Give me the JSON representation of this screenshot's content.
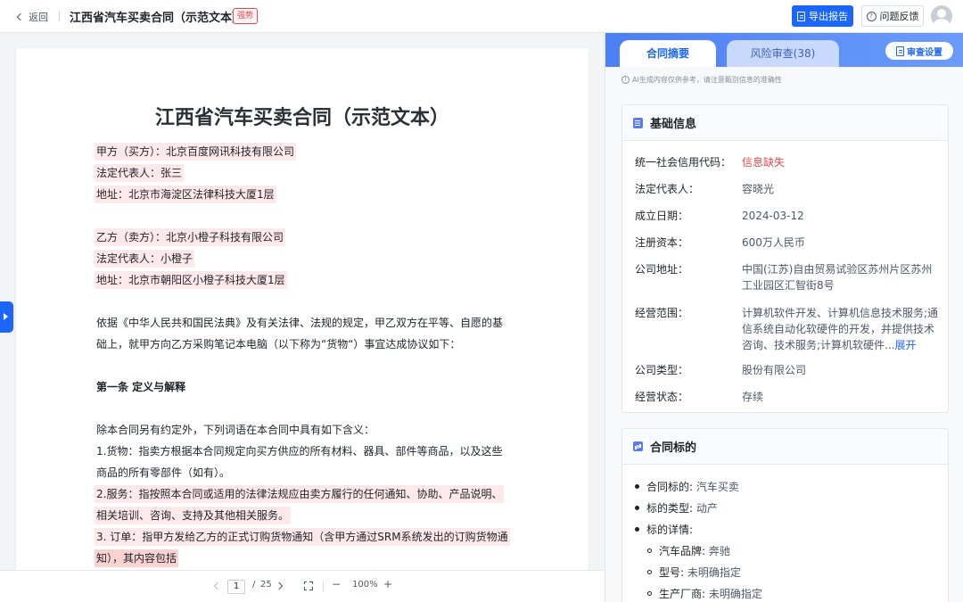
{
  "header": {
    "back_label": "返回",
    "doc_title": "江西省汽车买卖合同（示范文本）",
    "tag": "强势",
    "export_label": "导出报告",
    "feedback_label": "问题反馈"
  },
  "document": {
    "title": "江西省汽车买卖合同（示范文本）",
    "lines": [
      "甲方（买方）：北京百度网讯科技有限公司",
      "法定代表人：张三",
      "地址：北京市海淀区法律科技大厦1层",
      "乙方（卖方）：北京小橙子科技有限公司",
      "法定代表人：小橙子",
      "地址：北京市朝阳区小橙子科技大厦1层",
      "依据《中华人民共和国民法典》及有关法律、法规的规定，甲乙双方在平等、自愿的基",
      "础上，就甲方向乙方采购笔记本电脑（以下称为“货物“）事宜达成协议如下：",
      "第一条 定义与解释",
      "除本合同另有约定外，下列词语在本合同中具有如下含义：",
      "1.货物：指卖方根据本合同规定向买方供应的所有材料、器具、部件等商品，以及这些",
      "商品的所有零部件（如有）。",
      "2.服务：指按照本合同或适用的法律法规应由卖方履行的任何通知、协助、产品说明、",
      "相关培训、咨询、支持及其他相关服务。",
      "3. 订单：指甲方发给乙方的正式订购货物通知（含甲方通过SRM系统发出的订购货物通",
      "知），其内容包括"
    ]
  },
  "pager": {
    "current_page": "1",
    "separator": "/",
    "total_pages": "25",
    "zoom": "100%",
    "zoom_out": "−",
    "zoom_in": "+"
  },
  "panel": {
    "tab_summary": "合同摘要",
    "tab_risk": "风险审查(38)",
    "settings_label": "审查设置",
    "notice": "AI生成内容仅供参考，请注意甄别信息的准确性",
    "basic_info": {
      "title": "基础信息",
      "rows": [
        {
          "k": "统一社会信用代码：",
          "v": "信息缺失"
        },
        {
          "k": "法定代表人：",
          "v": "容晓光"
        },
        {
          "k": "成立日期：",
          "v": "2024-03-12"
        },
        {
          "k": "注册资本：",
          "v": "600万人民币"
        },
        {
          "k": "公司地址：",
          "v": "中国(江苏)自由贸易试验区苏州片区苏州工业园区汇智街8号"
        },
        {
          "k": "经营范围：",
          "v": "计算机软件开发、计算机信息技术服务;通信系统自动化软硬件的开发，并提供技术咨询、技术服务;计算机软硬件..."
        },
        {
          "k": "公司类型：",
          "v": "股份有限公司"
        },
        {
          "k": "经营状态：",
          "v": "存续"
        }
      ],
      "expand_label": "展开"
    },
    "subject": {
      "title": "合同标的",
      "items": [
        {
          "k": "合同标的:",
          "v": "汽车买卖"
        },
        {
          "k": "标的类型:",
          "v": "动产"
        },
        {
          "k": "标的详情:",
          "v": ""
        }
      ],
      "sub_items": [
        {
          "k": "汽车品牌:",
          "v": "奔驰"
        },
        {
          "k": "型号:",
          "v": "未明确指定"
        },
        {
          "k": "生产厂商:",
          "v": "未明确指定"
        }
      ]
    }
  },
  "colors": {
    "accent": "#1a66ff",
    "warning": "#e5484d",
    "highlight": "#fde9e9"
  }
}
